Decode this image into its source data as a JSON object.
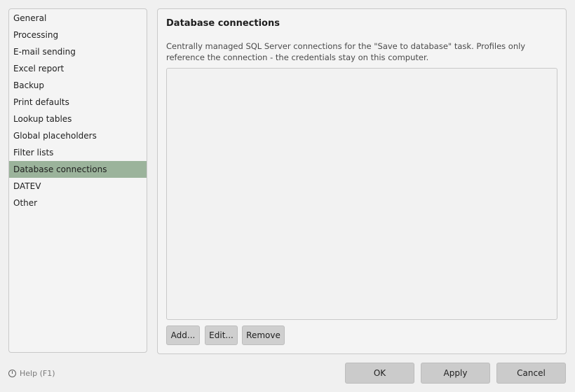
{
  "sidebar": {
    "items": [
      {
        "label": "General"
      },
      {
        "label": "Processing"
      },
      {
        "label": "E-mail sending"
      },
      {
        "label": "Excel report"
      },
      {
        "label": "Backup"
      },
      {
        "label": "Print defaults"
      },
      {
        "label": "Lookup tables"
      },
      {
        "label": "Global placeholders"
      },
      {
        "label": "Filter lists"
      },
      {
        "label": "Database connections"
      },
      {
        "label": "DATEV"
      },
      {
        "label": "Other"
      }
    ],
    "selected_index": 9,
    "selected_color": "#9bb39b"
  },
  "panel": {
    "title": "Database connections",
    "description": "Centrally managed SQL Server connections for the \"Save to database\" task. Profiles only reference the connection - the credentials stay on this computer.",
    "connections": [],
    "buttons": {
      "add": "Add...",
      "edit": "Edit...",
      "remove": "Remove"
    }
  },
  "footer": {
    "help_label": "Help (F1)",
    "help_icon": "help-circle-icon",
    "ok": "OK",
    "apply": "Apply",
    "cancel": "Cancel"
  }
}
